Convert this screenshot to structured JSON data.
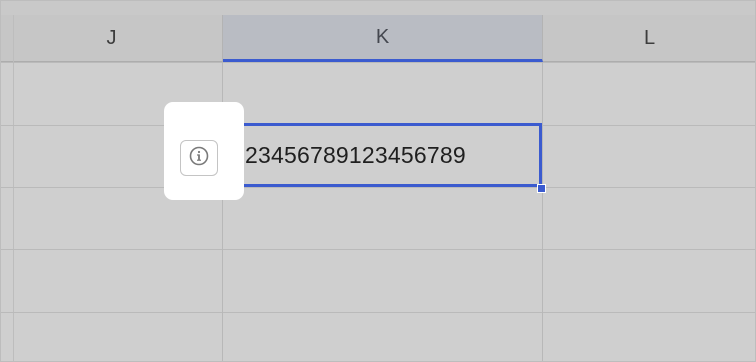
{
  "columns": [
    {
      "label": "J",
      "selected": false
    },
    {
      "label": "K",
      "selected": true
    },
    {
      "label": "L",
      "selected": false
    }
  ],
  "active_cell": {
    "column": "K",
    "value": "123456789123456789",
    "indicator_color": "#48a84e"
  },
  "info_button": {
    "icon": "info-icon"
  },
  "colors": {
    "selection": "#3b5bcf",
    "grid_bg": "#cfcfcf"
  }
}
